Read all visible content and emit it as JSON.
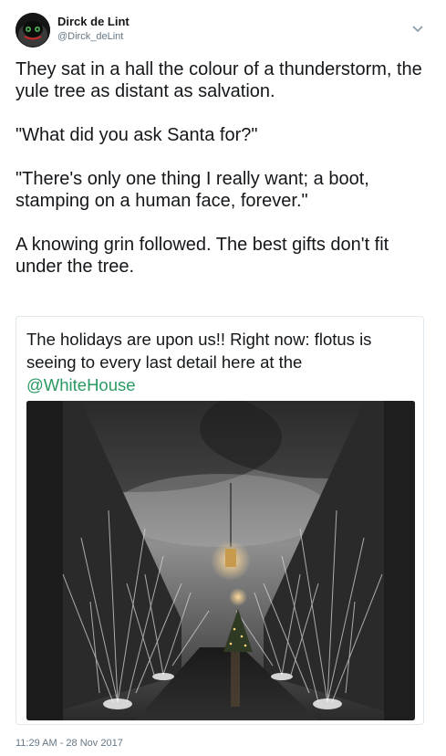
{
  "author": {
    "display_name": "Dirck de Lint",
    "handle": "@Dirck_deLint",
    "avatar_icon": "avatar-icon"
  },
  "tweet": {
    "paragraphs": [
      "They sat in a hall the colour of a thunderstorm, the yule tree as distant as salvation.",
      "\"What did you ask Santa for?\"",
      "\"There's only one thing I really want; a boot, stamping on a human face, forever.\"",
      "A knowing grin followed.  The best gifts don't fit under the tree."
    ],
    "timestamp": "11:29 AM - 28 Nov 2017"
  },
  "quoted_tweet": {
    "text": "The holidays are upon us!! Right now: flotus is seeing to every last detail here at the",
    "mention": "@WhiteHouse",
    "mention_color": "#2a9a62"
  },
  "colors": {
    "text": "#14171a",
    "secondary": "#657786",
    "border": "#e1e8ed"
  }
}
